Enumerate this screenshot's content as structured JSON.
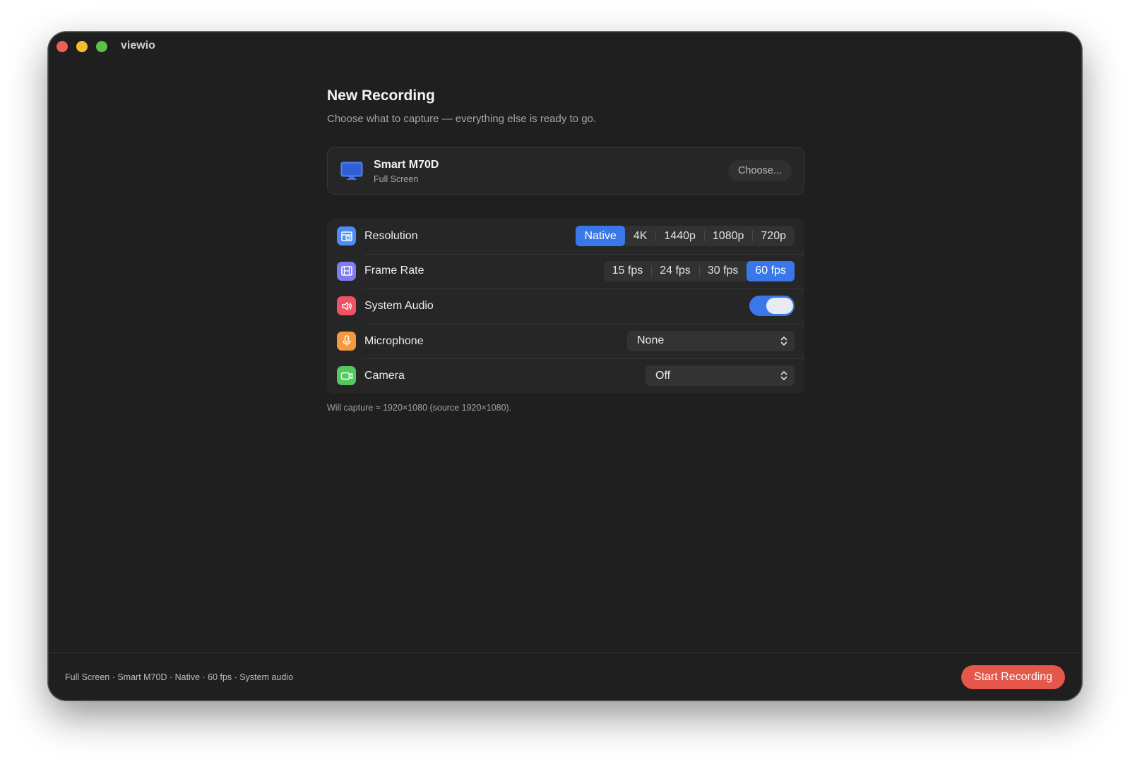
{
  "window": {
    "title": "viewio"
  },
  "header": {
    "title": "New Recording",
    "subtitle": "Choose what to capture — everything else is ready to go."
  },
  "source": {
    "icon": "display-icon",
    "name": "Smart M70D",
    "mode": "Full Screen",
    "choose_label": "Choose..."
  },
  "settings": {
    "resolution": {
      "label": "Resolution",
      "icon": "resolution-icon",
      "options": [
        "Native",
        "4K",
        "1440p",
        "1080p",
        "720p"
      ],
      "selected": "Native"
    },
    "frame_rate": {
      "label": "Frame Rate",
      "icon": "film-icon",
      "options": [
        "15 fps",
        "24 fps",
        "30 fps",
        "60 fps"
      ],
      "selected": "60 fps"
    },
    "system_audio": {
      "label": "System Audio",
      "icon": "speaker-icon",
      "enabled": true
    },
    "microphone": {
      "label": "Microphone",
      "icon": "microphone-icon",
      "value": "None"
    },
    "camera": {
      "label": "Camera",
      "icon": "camera-icon",
      "value": "Off"
    }
  },
  "capture_note": "Will capture ≈ 1920×1080 (source 1920×1080).",
  "footer": {
    "summary": "Full Screen · Smart M70D · Native · 60 fps · System audio",
    "start_label": "Start Recording"
  },
  "colors": {
    "accent": "#3a78ea",
    "record": "#e5574b",
    "window_bg": "#1f1f1f",
    "card_bg": "#262626"
  }
}
